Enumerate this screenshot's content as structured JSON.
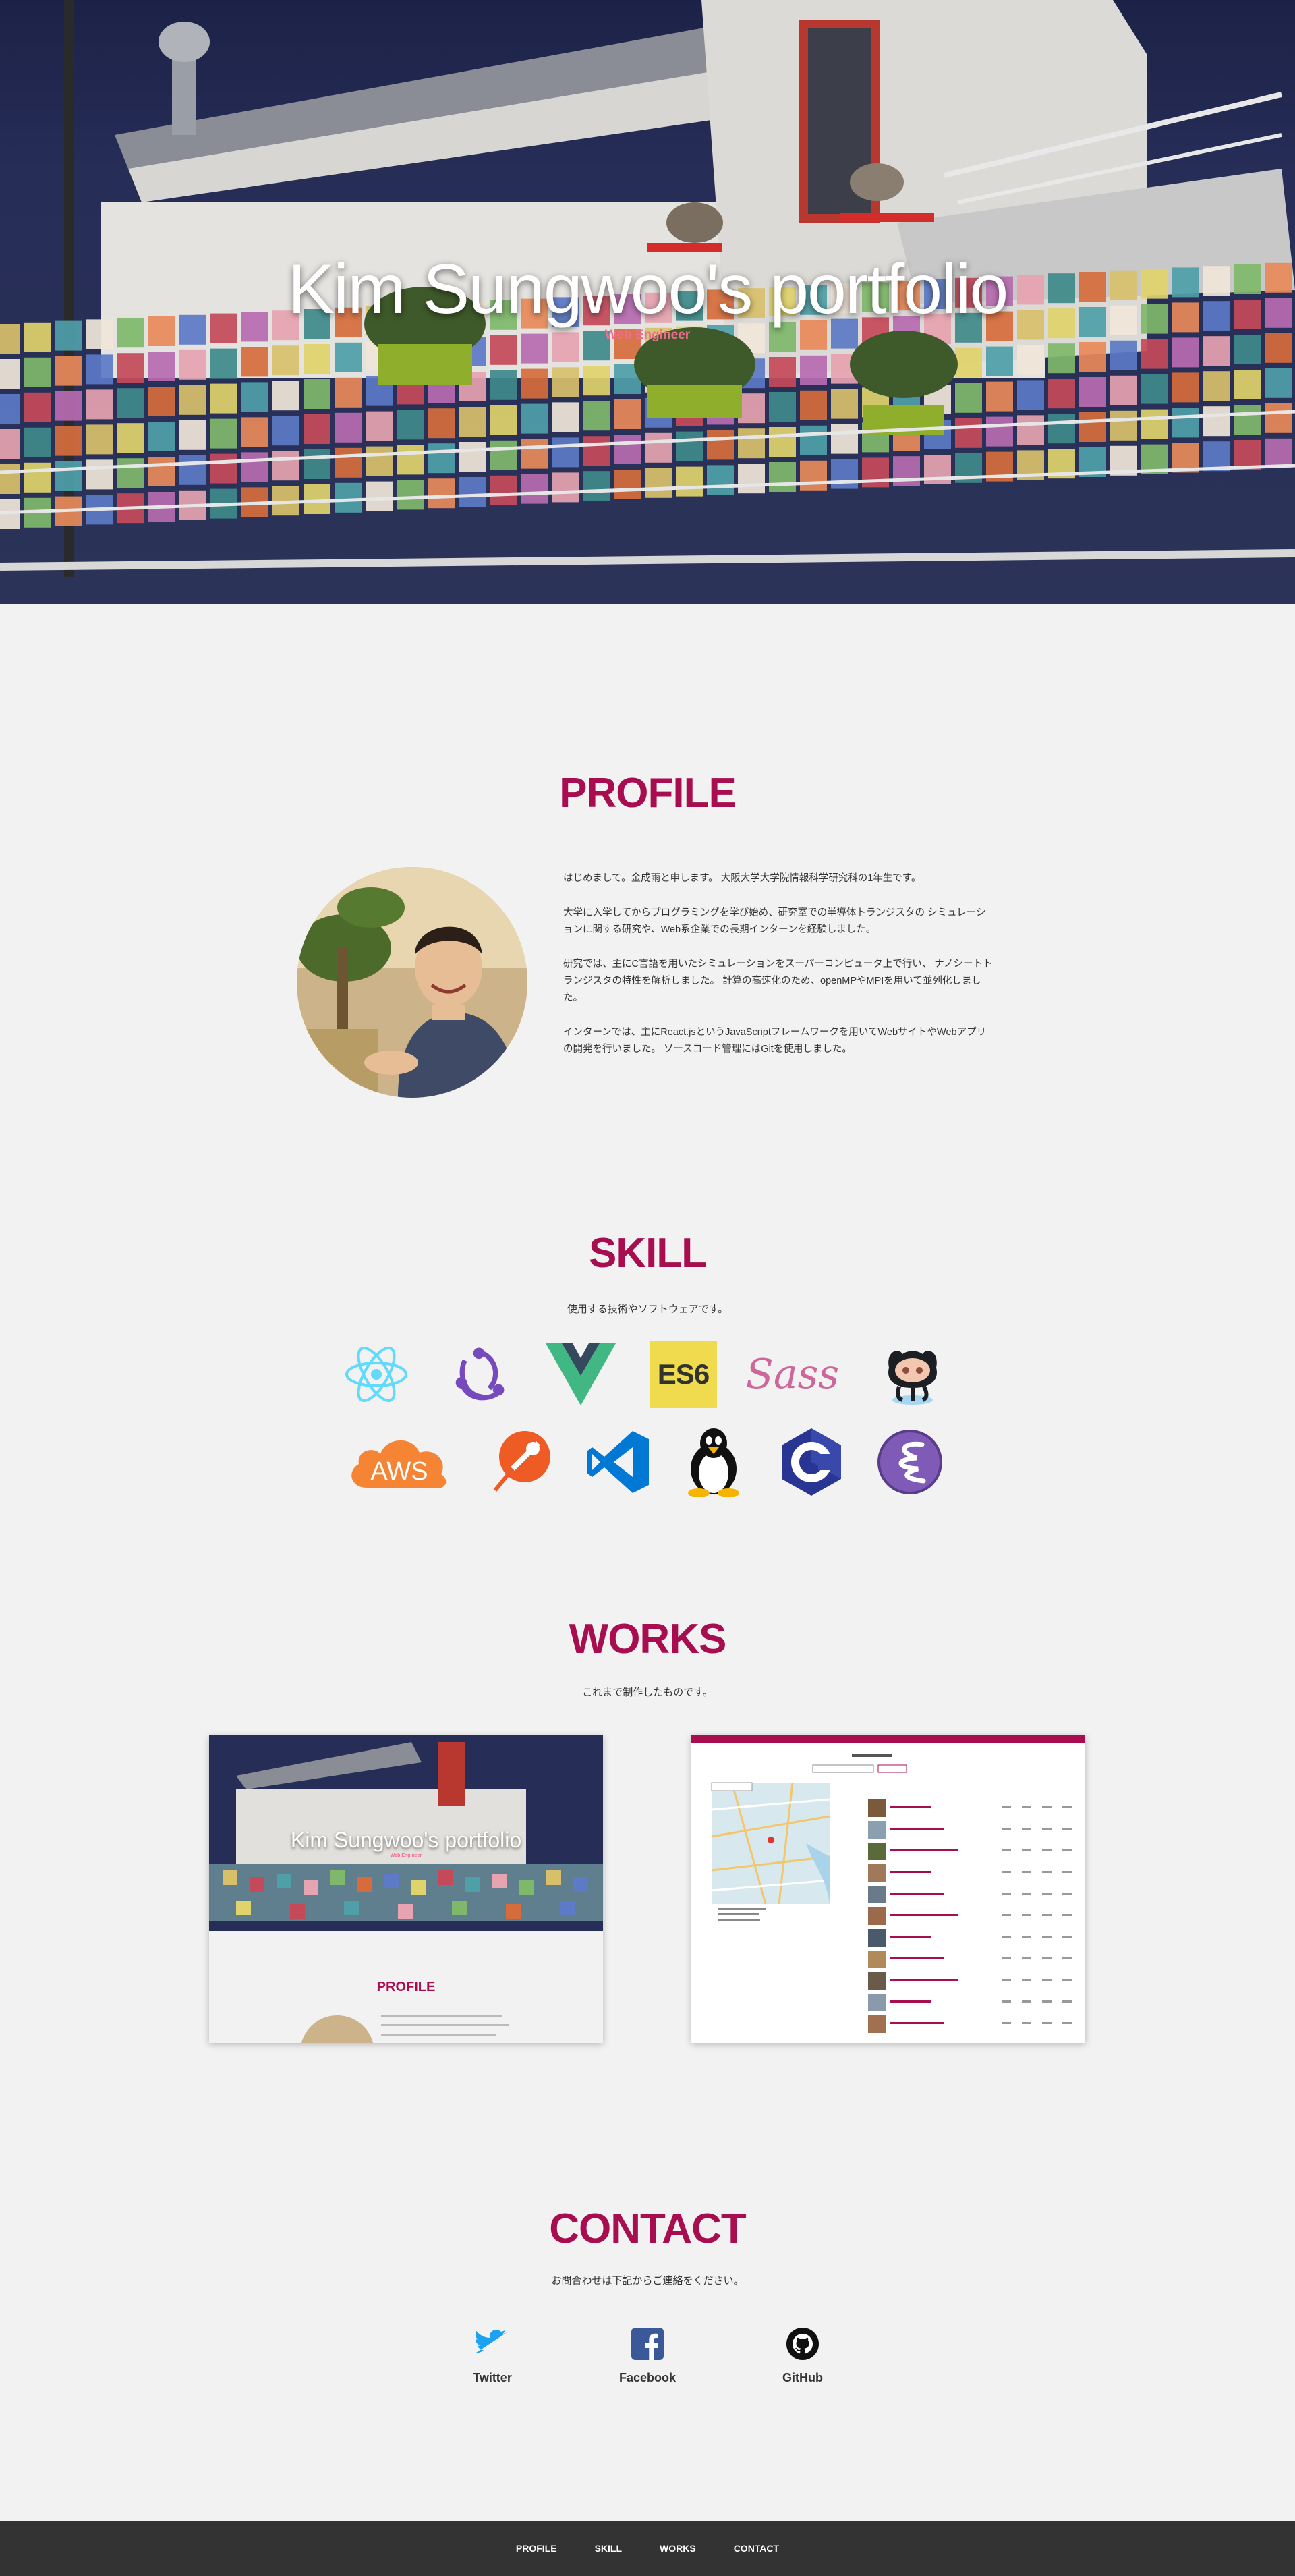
{
  "hero": {
    "title": "Kim Sungwoo's portfolio",
    "subtitle": "Web Engineer"
  },
  "profile": {
    "heading": "PROFILE",
    "paragraphs": [
      "はじめまして。金成雨と申します。 大阪大学大学院情報科学研究科の1年生です。",
      "大学に入学してからプログラミングを学び始め、研究室での半導体トランジスタの シミュレーションに関する研究や、Web系企業での長期インターンを経験しました。",
      "研究では、主にC言語を用いたシミュレーションをスーパーコンピュータ上で行い、 ナノシートトランジスタの特性を解析しました。 計算の高速化のため、openMPやMPIを用いて並列化しました。",
      "インターンでは、主にReact.jsというJavaScriptフレームワークを用いてWebサイトやWebアプリの開発を行いました。 ソースコード管理にはGitを使用しました。"
    ]
  },
  "skill": {
    "heading": "SKILL",
    "description": "使用する技術やソフトウェアです。",
    "icons": [
      "react-icon",
      "redux-icon",
      "vue-icon",
      "es6-icon",
      "sass-icon",
      "github-octocat-icon",
      "aws-icon",
      "postman-icon",
      "vscode-icon",
      "linux-tux-icon",
      "c-language-icon",
      "emacs-icon"
    ],
    "labels": {
      "es6": "ES6",
      "sass": "Sass",
      "aws": "AWS"
    }
  },
  "works": {
    "heading": "WORKS",
    "description": "これまで制作したものです。",
    "card1": {
      "title": "Kim Sungwoo's portfolio",
      "subtitle": "Web Engineer",
      "section": "PROFILE"
    }
  },
  "contact": {
    "heading": "CONTACT",
    "description": "お問合わせは下記からご連絡をください。",
    "items": [
      {
        "label": "Twitter",
        "icon": "twitter-icon"
      },
      {
        "label": "Facebook",
        "icon": "facebook-icon"
      },
      {
        "label": "GitHub",
        "icon": "github-icon"
      }
    ]
  },
  "footer": {
    "nav": [
      "PROFILE",
      "SKILL",
      "WORKS",
      "CONTACT"
    ]
  },
  "colors": {
    "accent": "#a80d50",
    "hero_sub": "#ef6b8f",
    "background": "#f2f2f2",
    "footer": "#333333"
  }
}
